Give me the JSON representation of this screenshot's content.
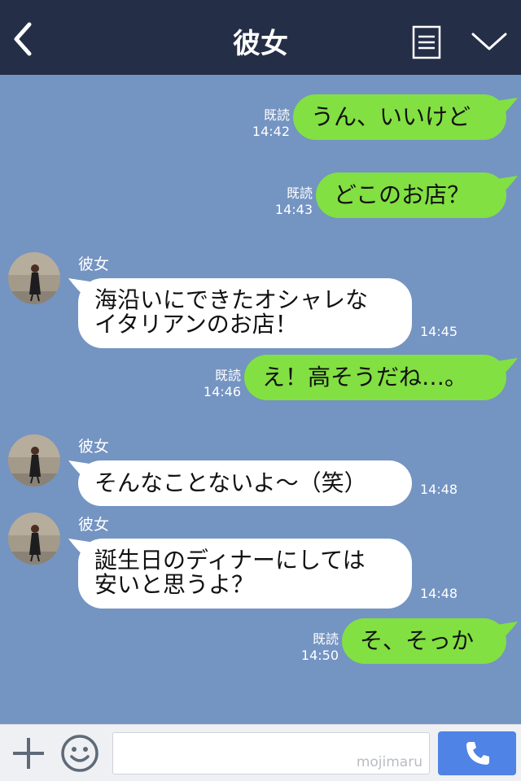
{
  "header": {
    "title": "彼女"
  },
  "colors": {
    "header_bg": "#252e47",
    "chat_bg": "#7494c2",
    "my_bubble": "#82e042",
    "their_bubble": "#ffffff",
    "call_button": "#4f83e6"
  },
  "messages": [
    {
      "from": "me",
      "text": "うん、いいけど",
      "read_label": "既読",
      "time": "14:42"
    },
    {
      "from": "me",
      "text": "どこのお店？",
      "read_label": "既読",
      "time": "14:43"
    },
    {
      "from": "them",
      "sender": "彼女",
      "text": "海沿いにできたオシャレな\nイタリアンのお店！",
      "time": "14:45"
    },
    {
      "from": "me",
      "text": "え！高そうだね…。",
      "read_label": "既読",
      "time": "14:46"
    },
    {
      "from": "them",
      "sender": "彼女",
      "text": "そんなことないよ～（笑）",
      "time": "14:48"
    },
    {
      "from": "them",
      "sender": "彼女",
      "text": "誕生日のディナーにしては\n安いと思うよ？",
      "time": "14:48"
    },
    {
      "from": "me",
      "text": "そ、そっか",
      "read_label": "既読",
      "time": "14:50"
    }
  ],
  "input_bar": {
    "watermark": "mojimaru",
    "icons": [
      "plus-icon",
      "smiley-icon",
      "phone-icon"
    ]
  }
}
